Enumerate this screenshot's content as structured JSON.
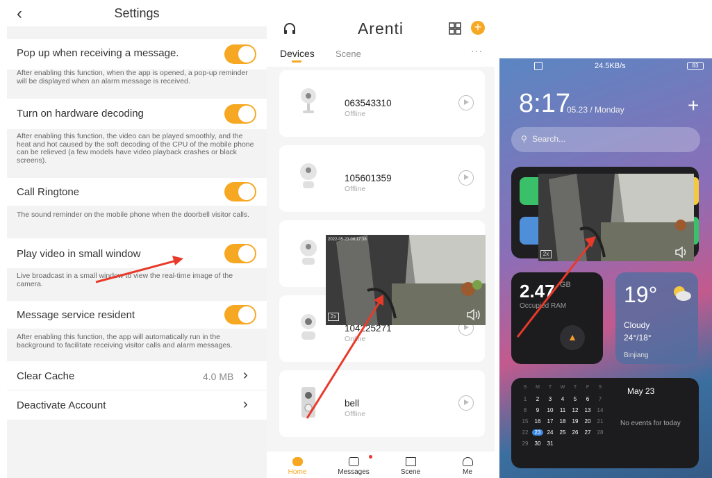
{
  "settings": {
    "title": "Settings",
    "rows": [
      {
        "label": "Pop up when receiving a message.",
        "desc": "After enabling this function, when the app is opened, a pop-up reminder will be displayed when an alarm message is received."
      },
      {
        "label": "Turn on hardware decoding",
        "desc": "After enabling this function, the video can be played smoothly, and the heat and hot caused by the soft decoding of the CPU of the mobile phone can be relieved (a few models have video playback crashes or black screens)."
      },
      {
        "label": "Call Ringtone",
        "desc": "The sound reminder on the mobile phone when the doorbell visitor calls."
      },
      {
        "label": "Play video in small window",
        "desc": "Live broadcast in a small window to view the real-time image of the camera."
      },
      {
        "label": "Message service resident",
        "desc": "After enabling this function, the app will automatically run in the background to facilitate receiving visitor calls and alarm messages."
      }
    ],
    "clear_cache": {
      "label": "Clear Cache",
      "value": "4.0 MB"
    },
    "deactivate": {
      "label": "Deactivate Account"
    }
  },
  "app": {
    "brand": "Arenti",
    "tabs": [
      "Devices",
      "Scene"
    ],
    "devices": [
      {
        "id": "063543310",
        "status": "Offline"
      },
      {
        "id": "105601359",
        "status": "Offline"
      },
      {
        "id": "",
        "status": ""
      },
      {
        "id": "104225271",
        "status": "Online"
      },
      {
        "id": "bell",
        "status": "Offline"
      }
    ],
    "video": {
      "zoom": "2x",
      "timestamp": "2022-05-23 08:17:38"
    },
    "bottom_nav": [
      "Home",
      "Messages",
      "Scene",
      "Me"
    ]
  },
  "phone": {
    "status_speed": "24.5KB/s",
    "battery": "83",
    "time": "8:17",
    "date": "05.23 / Monday",
    "search_placeholder": "Search...",
    "ram_value": "2.47",
    "ram_unit": "GB",
    "ram_label": "Occupied RAM",
    "weather": {
      "temp": "19°",
      "cond": "Cloudy",
      "range": "24°/18°",
      "city": "Binjiang"
    },
    "calendar": {
      "days": [
        "S",
        "M",
        "T",
        "W",
        "T",
        "F",
        "S"
      ],
      "title": "May 23",
      "events": "No events for today",
      "weeks": [
        [
          "1",
          "2",
          "3",
          "4",
          "5",
          "6",
          "7"
        ],
        [
          "8",
          "9",
          "10",
          "11",
          "12",
          "13",
          "14"
        ],
        [
          "15",
          "16",
          "17",
          "18",
          "19",
          "20",
          "21"
        ],
        [
          "22",
          "23",
          "24",
          "25",
          "26",
          "27",
          "28"
        ],
        [
          "29",
          "30",
          "31",
          "",
          "",
          "",
          ""
        ]
      ]
    },
    "video_zoom": "2x"
  }
}
